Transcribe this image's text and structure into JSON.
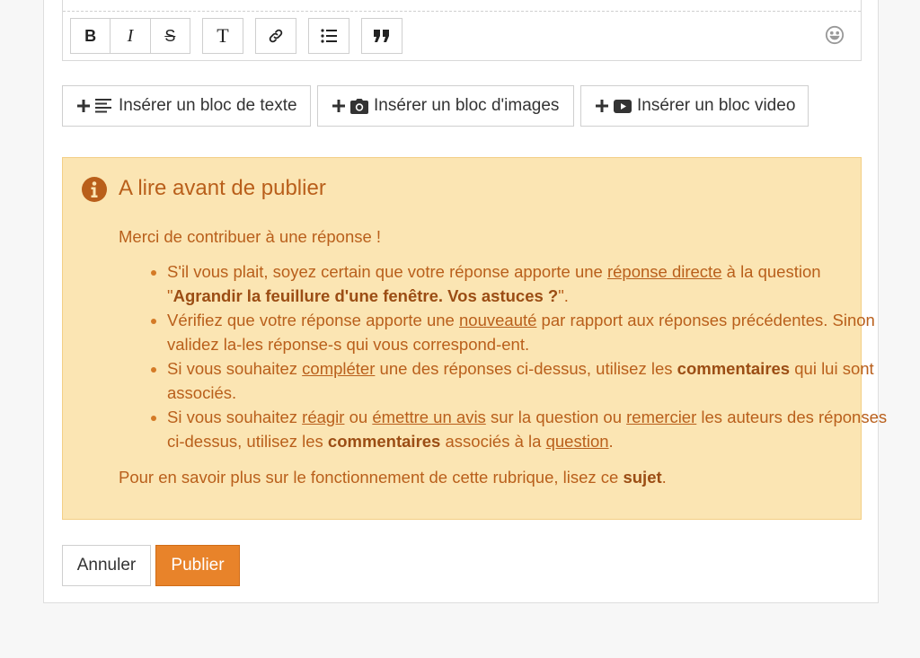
{
  "toolbar": {
    "bold": "B",
    "italic": "I",
    "strike": "S",
    "text_style": "T"
  },
  "insert_buttons": {
    "text_block": "Insérer un bloc de texte",
    "image_block": "Insérer un bloc d'images",
    "video_block": "Insérer un bloc video"
  },
  "alert": {
    "title": "A lire avant de publier",
    "intro": "Merci de contribuer à une réponse !",
    "item1": {
      "t1": "S'il vous plait, soyez certain que votre réponse apporte une ",
      "link1": "réponse directe",
      "t2": " à la question \"",
      "bold1": "Agrandir la feuillure d'une fenêtre. Vos astuces ?",
      "t3": "\"."
    },
    "item2": {
      "t1": "Vérifiez que votre réponse apporte une ",
      "link1": "nouveauté",
      "t2": " par rapport aux réponses précédentes. Sinon validez la-les réponse-s qui vous correspond-ent."
    },
    "item3": {
      "t1": "Si vous souhaitez ",
      "link1": "compléter",
      "t2": " une des réponses ci-dessus, utilisez les ",
      "bold1": "commentaires",
      "t3": " qui lui sont associés."
    },
    "item4": {
      "t1": "Si vous souhaitez ",
      "link1": "réagir",
      "t2": " ou ",
      "link2": "émettre un avis",
      "t3": " sur la question ou ",
      "link3": "remercier",
      "t4": " les auteurs des réponses ci-dessus, utilisez les ",
      "bold1": "commentaires",
      "t5": " associés à la ",
      "link4": "question",
      "t6": "."
    },
    "outro": {
      "t1": "Pour en savoir plus sur le fonctionnement de cette rubrique, lisez ce ",
      "bold1": "sujet",
      "t2": "."
    }
  },
  "actions": {
    "cancel": "Annuler",
    "publish": "Publier"
  },
  "colors": {
    "alert_bg": "#fbe5b3",
    "alert_text": "#b95f1b",
    "publish_bg": "#e8832a"
  },
  "icons": [
    "bold-icon",
    "italic-icon",
    "strikethrough-icon",
    "text-style-icon",
    "link-icon",
    "list-icon",
    "quote-icon",
    "smiley-icon",
    "plus-icon",
    "text-lines-icon",
    "camera-icon",
    "video-icon",
    "info-icon"
  ]
}
